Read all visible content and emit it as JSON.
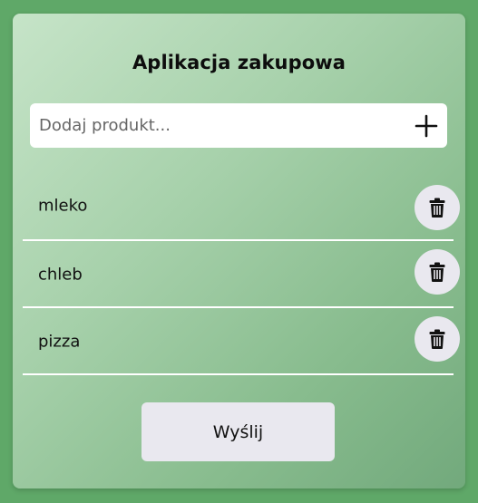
{
  "app": {
    "title": "Aplikacja zakupowa"
  },
  "add_product": {
    "placeholder": "Dodaj produkt...",
    "value": "",
    "button_icon": "plus-icon"
  },
  "products": [
    {
      "name": "mleko",
      "delete_icon": "trash-icon"
    },
    {
      "name": "chleb",
      "delete_icon": "trash-icon"
    },
    {
      "name": "pizza",
      "delete_icon": "trash-icon"
    }
  ],
  "submit": {
    "label": "Wyślij"
  },
  "colors": {
    "page_background": "#5fa868",
    "card_gradient_start": "#c6e4c8",
    "card_gradient_end": "#72a97c",
    "button_background": "#e9e8ef",
    "divider": "#ffffff"
  }
}
